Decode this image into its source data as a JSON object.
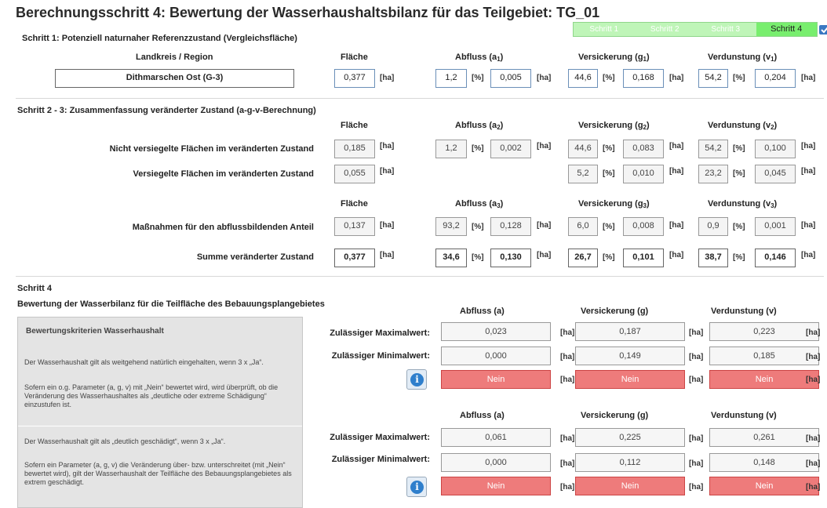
{
  "title": "Berechnungsschritt 4: Bewertung der Wasserhaushaltsbilanz für das Teilgebiet: TG_01",
  "steps": [
    {
      "label": "Schritt 1"
    },
    {
      "label": "Schritt 2"
    },
    {
      "label": "Schritt 3"
    },
    {
      "label": "Schritt 4",
      "active": true
    }
  ],
  "section1": {
    "title": "Schritt 1: Potenziell naturnaher Referenzzustand (Vergleichsfläche)",
    "region_label": "Landkreis / Region",
    "region_value": "Dithmarschen Ost (G-3)",
    "headers": {
      "flaeche": "Fläche",
      "abfluss": "Abfluss (a",
      "abfluss_sub": "1",
      "versickerung": "Versickerung (g",
      "versickerung_sub": "1",
      "verdunstung": "Verdunstung (v",
      "verdunstung_sub": "1",
      "close": ")"
    },
    "values": {
      "flaeche": "0,377",
      "a_pct": "1,2",
      "a_ha": "0,005",
      "g_pct": "44,6",
      "g_ha": "0,168",
      "v_pct": "54,2",
      "v_ha": "0,204"
    }
  },
  "units": {
    "ha": "[ha]",
    "pct": "[%]"
  },
  "section2": {
    "title": "Schritt 2 - 3: Zusammenfassung veränderter Zustand (a-g-v-Berechnung)",
    "headers1": {
      "flaeche": "Fläche",
      "abfluss": "Abfluss (a",
      "abfluss_sub": "2",
      "versickerung": "Versickerung (g",
      "versickerung_sub": "2",
      "verdunstung": "Verdunstung (v",
      "verdunstung_sub": "2",
      "close": ")"
    },
    "row1": {
      "label": "Nicht versiegelte Flächen im veränderten  Zustand",
      "flaeche": "0,185",
      "a_pct": "1,2",
      "a_ha": "0,002",
      "g_pct": "44,6",
      "g_ha": "0,083",
      "v_pct": "54,2",
      "v_ha": "0,100"
    },
    "row2": {
      "label": "Versiegelte Flächen im veränderten  Zustand",
      "flaeche": "0,055",
      "g_pct": "5,2",
      "g_ha": "0,010",
      "v_pct": "23,2",
      "v_ha": "0,045"
    },
    "headers2": {
      "flaeche": "Fläche",
      "abfluss": "Abfluss (a",
      "abfluss_sub": "3",
      "versickerung": "Versickerung (g",
      "versickerung_sub": "3",
      "verdunstung": "Verdunstung (v",
      "verdunstung_sub": "3",
      "close": ")"
    },
    "row3": {
      "label": "Maßnahmen für den abflussbildenden Anteil",
      "flaeche": "0,137",
      "a_pct": "93,2",
      "a_ha": "0,128",
      "g_pct": "6,0",
      "g_ha": "0,008",
      "v_pct": "0,9",
      "v_ha": "0,001"
    },
    "row4": {
      "label": "Summe veränderter Zustand",
      "flaeche": "0,377",
      "a_pct": "34,6",
      "a_ha": "0,130",
      "g_pct": "26,7",
      "g_ha": "0,101",
      "v_pct": "38,7",
      "v_ha": "0,146"
    }
  },
  "section4": {
    "title": "Schritt 4",
    "subtitle": "Bewertung der Wasserbilanz für die Teilfläche des Bebauungsplangebietes",
    "criteria": {
      "title": "Bewertungskriterien Wasserhaushalt",
      "p1": "Der Wasserhaushalt gilt als weitgehend natürlich eingehalten, wenn 3 x „Ja“.",
      "p2": "Sofern ein o.g. Parameter (a, g, v) mit „Nein“ bewertet wird, wird überprüft, ob die Veränderung des Wasserhaushaltes als „deutliche oder extreme Schädigung“ einzustufen ist.",
      "p3": "Der Wasserhaushalt gilt als „deutlich geschädigt“, wenn 3 x „Ja“.",
      "p4": "Sofern ein Parameter (a, g, v) die Veränderung über- bzw. unterschreitet (mit „Nein“ bewertet wird), gilt der Wasserhaushalt der Teilfläche des Bebauungsplangebietes als extrem geschädigt."
    },
    "col_headers": {
      "a": "Abfluss (a)",
      "g": "Versickerung (g)",
      "v": "Verdunstung (v)"
    },
    "max_label": "Zulässiger Maximalwert:",
    "min_label": "Zulässiger Minimalwert:",
    "block1": {
      "max": {
        "a": "0,023",
        "g": "0,187",
        "v": "0,223"
      },
      "min": {
        "a": "0,000",
        "g": "0,149",
        "v": "0,185"
      },
      "result": {
        "a": "Nein",
        "g": "Nein",
        "v": "Nein"
      }
    },
    "block2": {
      "max": {
        "a": "0,061",
        "g": "0,225",
        "v": "0,261"
      },
      "min": {
        "a": "0,000",
        "g": "0,112",
        "v": "0,148"
      },
      "result": {
        "a": "Nein",
        "g": "Nein",
        "v": "Nein"
      }
    },
    "info_glyph": "i"
  },
  "colors": {
    "accent_green": "#78ee6e",
    "nein_red": "#ee7b7b",
    "info_blue": "#2f7fcc"
  }
}
